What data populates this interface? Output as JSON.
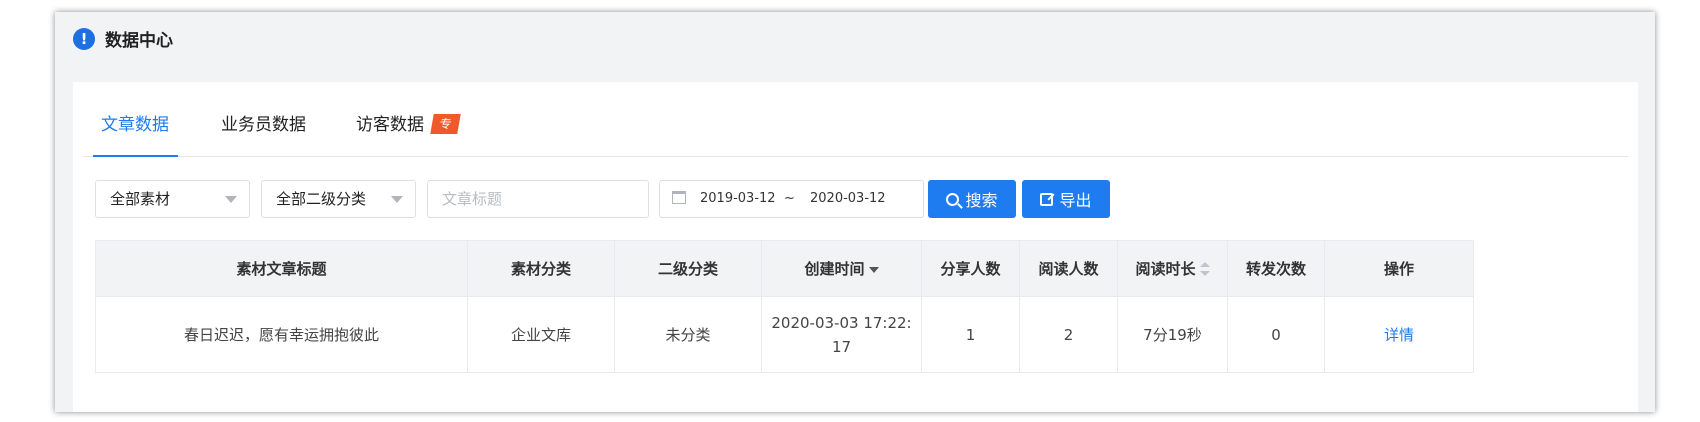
{
  "header": {
    "title": "数据中心",
    "icon": "exclamation-icon"
  },
  "tabs": [
    {
      "label": "文章数据",
      "active": true
    },
    {
      "label": "业务员数据",
      "active": false
    },
    {
      "label": "访客数据",
      "active": false,
      "badge": "专"
    }
  ],
  "filters": {
    "material_select": "全部素材",
    "category_select": "全部二级分类",
    "title_placeholder": "文章标题",
    "date_start": "2019-03-12",
    "date_separator": "~",
    "date_end": "2020-03-12",
    "search_label": "搜索",
    "export_label": "导出"
  },
  "table": {
    "columns": [
      "素材文章标题",
      "素材分类",
      "二级分类",
      "创建时间",
      "分享人数",
      "阅读人数",
      "阅读时长",
      "转发次数",
      "操作"
    ],
    "rows": [
      [
        "春日迟迟，愿有幸运拥抱彼此",
        "企业文库",
        "未分类",
        "2020-03-03 17:22:17",
        "1",
        "2",
        "7分19秒",
        "0",
        "详情"
      ]
    ]
  },
  "colors": {
    "accent": "#1f7bf0",
    "badge": "#f05a2b"
  }
}
